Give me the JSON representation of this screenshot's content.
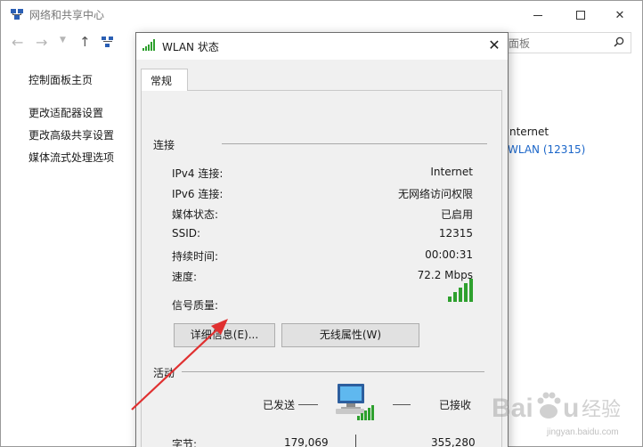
{
  "background_window": {
    "title": "网络和共享中心",
    "search_placeholder": "面板",
    "sidebar": {
      "home": "控制面板主页",
      "items": [
        {
          "label": "更改适配器设置"
        },
        {
          "label": "更改高级共享设置"
        },
        {
          "label": "媒体流式处理选项"
        }
      ]
    },
    "network_access_type": "nternet",
    "connection_link": "WLAN (12315)",
    "link_color": "#1b66c9"
  },
  "dialog": {
    "title": "WLAN 状态",
    "tab_label": "常规",
    "connection_section": "连接",
    "rows": [
      {
        "label": "IPv4 连接:",
        "value": "Internet"
      },
      {
        "label": "IPv6 连接:",
        "value": "无网络访问权限"
      },
      {
        "label": "媒体状态:",
        "value": "已启用"
      },
      {
        "label": "SSID:",
        "value": "12315"
      },
      {
        "label": "持续时间:",
        "value": "00:00:31"
      },
      {
        "label": "速度:",
        "value": "72.2 Mbps"
      }
    ],
    "signal_quality_label": "信号质量:",
    "signal_level_bars": 5,
    "signal_total_bars": 5,
    "buttons": {
      "details": "详细信息(E)...",
      "wireless_properties": "无线属性(W)"
    },
    "activity_section": "活动",
    "activity": {
      "sent_label": "已发送",
      "received_label": "已接收",
      "bytes_label": "字节:",
      "bytes_sent": "179,069",
      "bytes_received": "355,280"
    }
  },
  "watermark": {
    "brand": "Baidu 经验",
    "sub": "jingyan.baidu.com"
  },
  "colors": {
    "annotation_arrow": "#e03030",
    "signal_green": "#2ea02e",
    "link": "#1b66c9"
  }
}
